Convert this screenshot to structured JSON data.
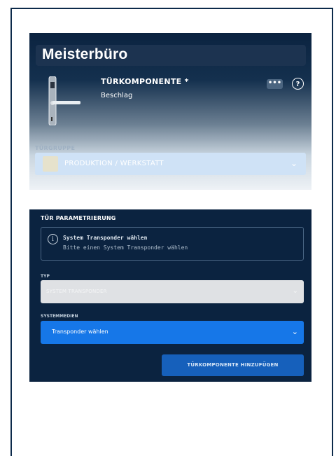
{
  "door": {
    "name": "Meisterbüro",
    "component_label": "TÜRKOMPONENTE *",
    "component_value": "Beschlag",
    "more_label": "•••",
    "help_label": "?",
    "group_label": "TÜRGRUPPE",
    "group_value": "PRODUKTION / WERKSTATT",
    "group_color": "#e6e2cc"
  },
  "param": {
    "title": "TÜR PARAMETRIERUNG",
    "info_title": "System Transponder wählen",
    "info_text": "Bitte einen System Transponder wählen",
    "typ_label": "TYP",
    "typ_value": "SYSTEM TRANSPONDER",
    "sys_label": "SYSTEMMEDIEN",
    "sys_value": "Transponder wählen",
    "add_button": "TÜRKOMPONENTE HINZUFÜGEN"
  },
  "colors": {
    "navy": "#0b2340",
    "accent": "#1677e8",
    "button": "#1660bb"
  },
  "icons": {
    "handle": "door-handle-icon",
    "more": "more-icon",
    "help": "help-icon",
    "info": "info-icon",
    "chevron": "chevron-down-icon"
  }
}
